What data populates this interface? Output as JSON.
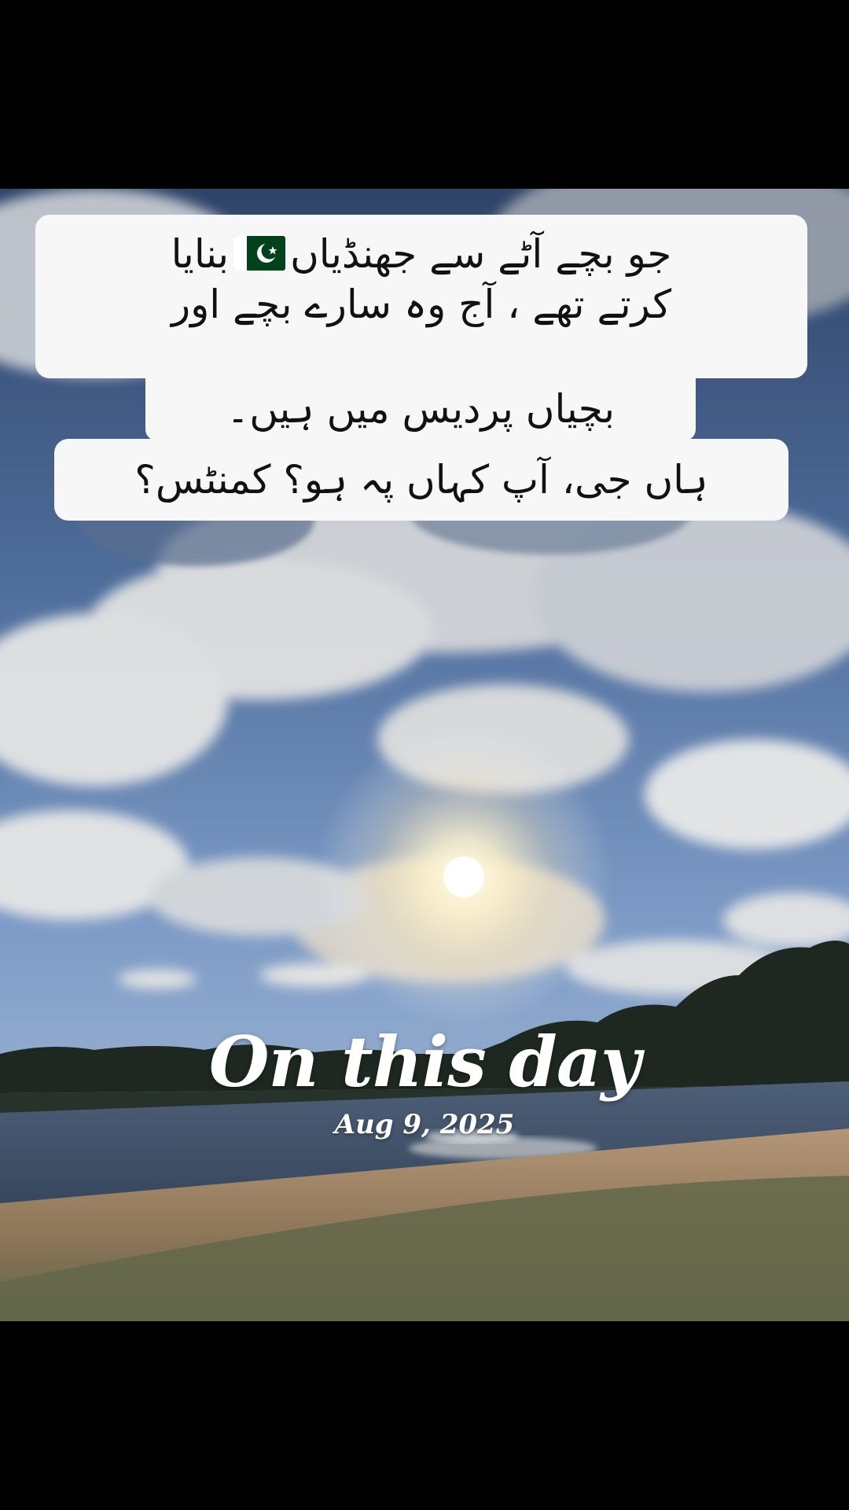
{
  "caption": {
    "line1": "جو بچے آٹے سے جھنڈیاں",
    "line1_end": "بنایا",
    "flag_icon": "pakistan-flag-icon",
    "line2": "کرتے تھے ، آج وہ سارے بچے اور",
    "line3": "بچیاں پردیس میں ہیں۔",
    "line4": "ہاں جی، آپ کہاں پہ ہو؟ کمنٹس؟"
  },
  "memory": {
    "title": "On this day",
    "date": "Aug 9, 2025"
  },
  "colors": {
    "sky_top": "#3c5a86",
    "sky_mid": "#6f8db8",
    "sky_low": "#a9bedb",
    "water": "#56687f",
    "sand": "#a88a6c",
    "grass": "#6c6b4a",
    "trees": "#1f2a22",
    "caption_bg": "#f7f7f7",
    "flag_green": "#01411c"
  }
}
